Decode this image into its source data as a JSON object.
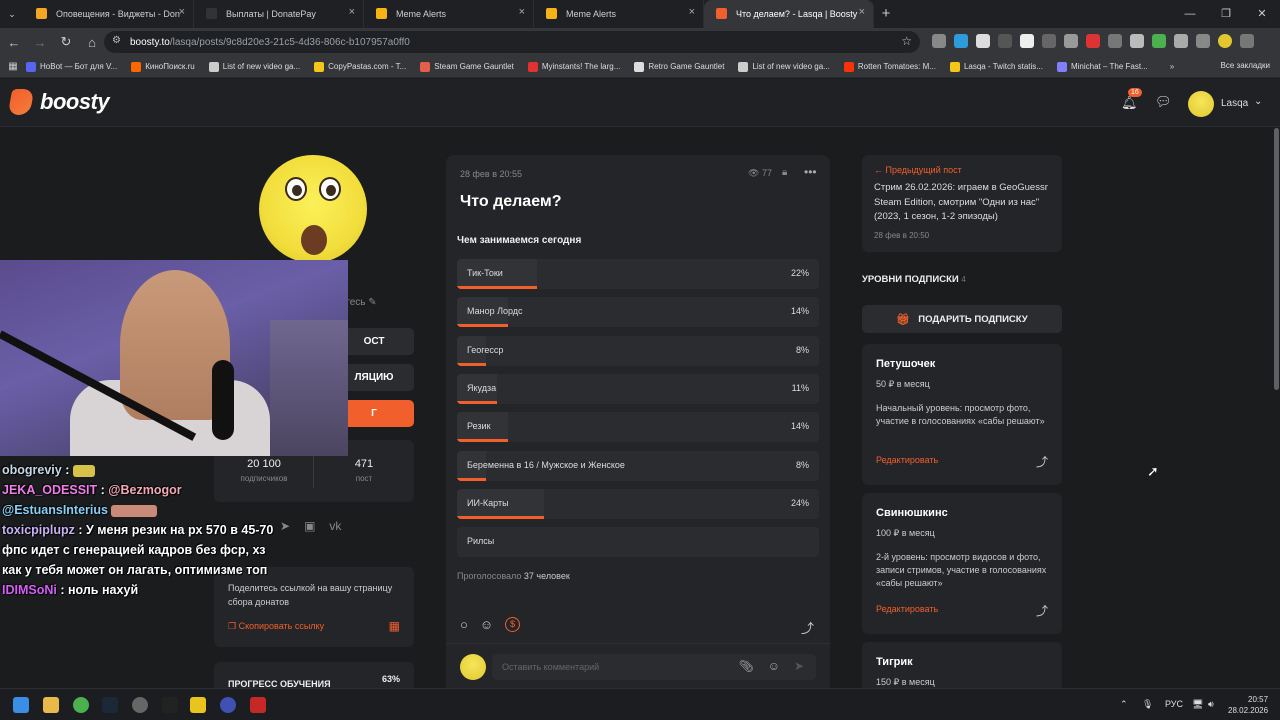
{
  "browser": {
    "tabs": [
      {
        "title": "Оповещения - Виджеты - Don",
        "color": "#f5a623",
        "active": false
      },
      {
        "title": "Выплаты | DonatePay",
        "color": "#333333",
        "active": false
      },
      {
        "title": "Meme Alerts",
        "color": "#f5b316",
        "active": false
      },
      {
        "title": "Meme Alerts",
        "color": "#f5b316",
        "active": false
      },
      {
        "title": "Что делаем? - Lasqa | Boosty",
        "color": "#f15f2c",
        "active": true
      }
    ],
    "url_host": "boosty.to",
    "url_path": "/lasqa/posts/9c8d20e3-21c5-4d36-806c-b107957a0ff0",
    "bookmarks": [
      {
        "label": "HoBot — Бот для V...",
        "color": "#5865f2"
      },
      {
        "label": "КиноПоиск.ru",
        "color": "#ff6600"
      },
      {
        "label": "List of new video ga...",
        "color": "#cccccc"
      },
      {
        "label": "CopyPastas.com - T...",
        "color": "#f5c518"
      },
      {
        "label": "Steam Game Gauntlet",
        "color": "#e45f4a"
      },
      {
        "label": "Myinstants! The larg...",
        "color": "#e0322f"
      },
      {
        "label": "Retro Game Gauntlet",
        "color": "#dddddd"
      },
      {
        "label": "List of new video ga...",
        "color": "#cccccc"
      },
      {
        "label": "Rotten Tomatoes: M...",
        "color": "#fa320a"
      },
      {
        "label": "Lasqa - Twitch statis...",
        "color": "#f5c518"
      },
      {
        "label": "Minichat – The Fast...",
        "color": "#7f7fff"
      }
    ],
    "all_bookmarks": "Все закладки"
  },
  "header": {
    "logo": "boosty",
    "notif_count": "16",
    "user_name": "Lasqa"
  },
  "left": {
    "edit_text": "етесь",
    "buttons": [
      "ОСТ",
      "ЛЯЦИЮ",
      "Г"
    ],
    "subscribers_value": "20 100",
    "subscribers_label": "подписчиков",
    "posts_value": "471",
    "posts_label": "пост",
    "share_text": "Поделитесь ссылкой на вашу страницу сбора донатов",
    "copy_link": "Скопировать ссылку",
    "progress_title": "ПРОГРЕСС ОБУЧЕНИЯ",
    "progress_value": "63%"
  },
  "chat": [
    {
      "user": "obogreviy",
      "text": ""
    },
    {
      "user": "JEKA_ODESSIT",
      "mention": "@Bezmogor",
      "text": ""
    },
    {
      "user": "@EstuansInterius",
      "text": ""
    },
    {
      "user": "toxicpiplupz",
      "text": "У меня резик на рх 570 в 45-70 фпс идет с генерацией кадров без фср, хз как у тебя может он лагать, оптимизме топ"
    },
    {
      "user": "IDIMSoNi",
      "text": "ноль нахуй"
    }
  ],
  "post": {
    "date": "28 фев в 20:55",
    "views": "77",
    "title": "Что делаем?",
    "poll_question": "Чем занимаемся сегодня",
    "options": [
      {
        "label": "Тик-Токи",
        "pct": "22%",
        "value": 22
      },
      {
        "label": "Манор Лордс",
        "pct": "14%",
        "value": 14
      },
      {
        "label": "Геогесср",
        "pct": "8%",
        "value": 8
      },
      {
        "label": "Якудза",
        "pct": "11%",
        "value": 11
      },
      {
        "label": "Резик",
        "pct": "14%",
        "value": 14
      },
      {
        "label": "Беременна в 16 / Мужское и Женское",
        "pct": "8%",
        "value": 8
      },
      {
        "label": "ИИ-Карты",
        "pct": "24%",
        "value": 24
      },
      {
        "label": "Рилсы",
        "pct": "",
        "value": 0
      }
    ],
    "voted_label": "Проголосовало",
    "voted_count": "37 человек",
    "comment_placeholder": "Оставить комментарий"
  },
  "right": {
    "prev_label": "Предыдущий пост",
    "prev_text": "Стрим 26.02.2026: играем в GeoGuessr Steam Edition, смотрим \"Одни из нас\" (2023, 1 сезон, 1-2 эпизоды)",
    "prev_date": "28 фев в 20:50",
    "levels_title": "УРОВНИ ПОДПИСКИ",
    "levels_count": "4",
    "gift_label": "ПОДАРИТЬ ПОДПИСКУ",
    "tiers": [
      {
        "name": "Петушочек",
        "price": "50 ₽ в месяц",
        "desc": "Начальный уровень: просмотр фото, участие в голосованиях «сабы решают»",
        "edit": "Редактировать"
      },
      {
        "name": "Свинюшкинс",
        "price": "100 ₽ в месяц",
        "desc": "2-й уровень: просмотр видосов и фото, записи стримов, участие в голосованиях «сабы решают»",
        "edit": "Редактировать"
      },
      {
        "name": "Тигрик",
        "price": "150 ₽ в месяц",
        "desc": "",
        "edit": ""
      }
    ]
  },
  "taskbar": {
    "lang": "РУС",
    "time": "20:57",
    "date": "28.02.2026"
  }
}
